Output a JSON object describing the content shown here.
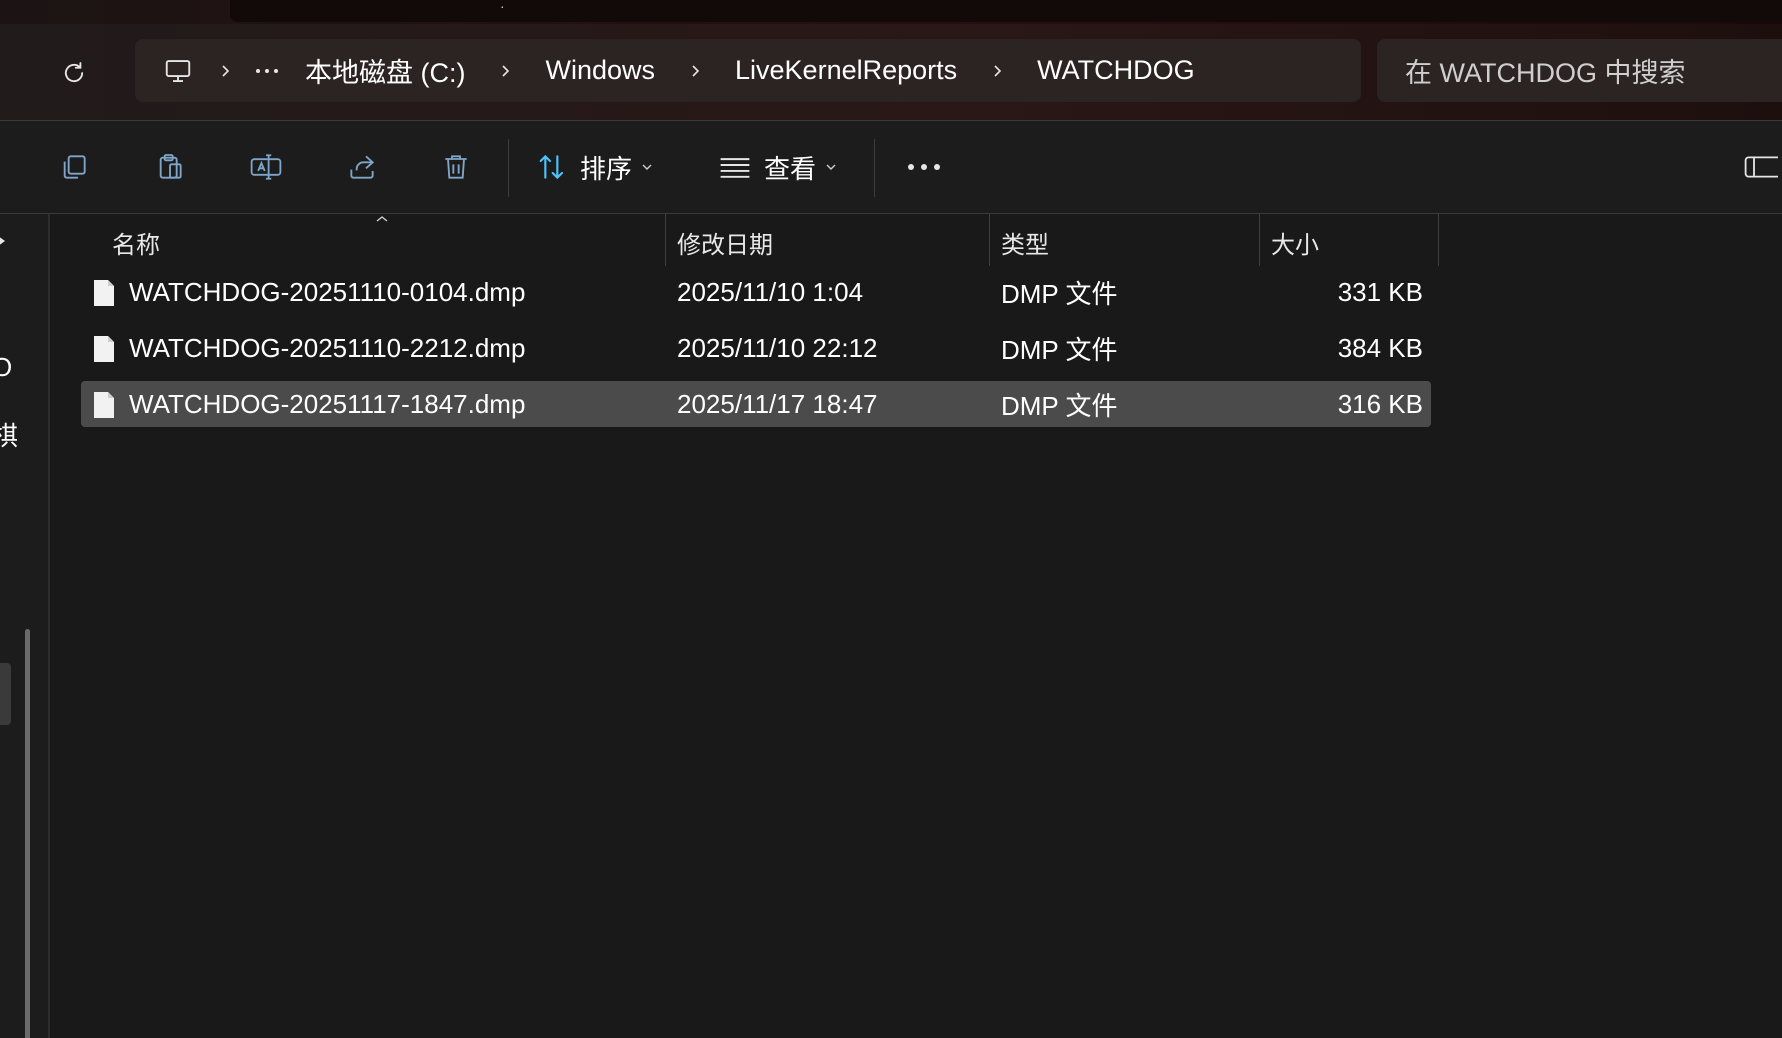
{
  "title_bar": {
    "tab_glyph": "·"
  },
  "breadcrumb": {
    "items": [
      "本地磁盘 (C:)",
      "Windows",
      "LiveKernelReports",
      "WATCHDOG"
    ]
  },
  "search": {
    "placeholder": "在 WATCHDOG 中搜索"
  },
  "toolbar": {
    "sort_label": "排序",
    "view_label": "查看",
    "icons": [
      "copy-icon",
      "paste-icon",
      "rename-icon",
      "share-icon",
      "delete-icon",
      "sort-icon",
      "view-icon",
      "more-icon",
      "details-pane-icon"
    ]
  },
  "nav_pane": {
    "fragments": [
      "O",
      "棋",
      ")"
    ]
  },
  "columns": {
    "name": "名称",
    "modified": "修改日期",
    "type": "类型",
    "size": "大小"
  },
  "files": [
    {
      "name": "WATCHDOG-20251110-0104.dmp",
      "modified": "2025/11/10 1:04",
      "type": "DMP 文件",
      "size": "331 KB",
      "selected": false
    },
    {
      "name": "WATCHDOG-20251110-2212.dmp",
      "modified": "2025/11/10 22:12",
      "type": "DMP 文件",
      "size": "384 KB",
      "selected": false
    },
    {
      "name": "WATCHDOG-20251117-1847.dmp",
      "modified": "2025/11/17 18:47",
      "type": "DMP 文件",
      "size": "316 KB",
      "selected": true
    }
  ],
  "colors": {
    "background": "#191919",
    "selected_row": "#4b4b4b",
    "accent": "#4cc2ff",
    "address_bar": "#2c2323"
  }
}
